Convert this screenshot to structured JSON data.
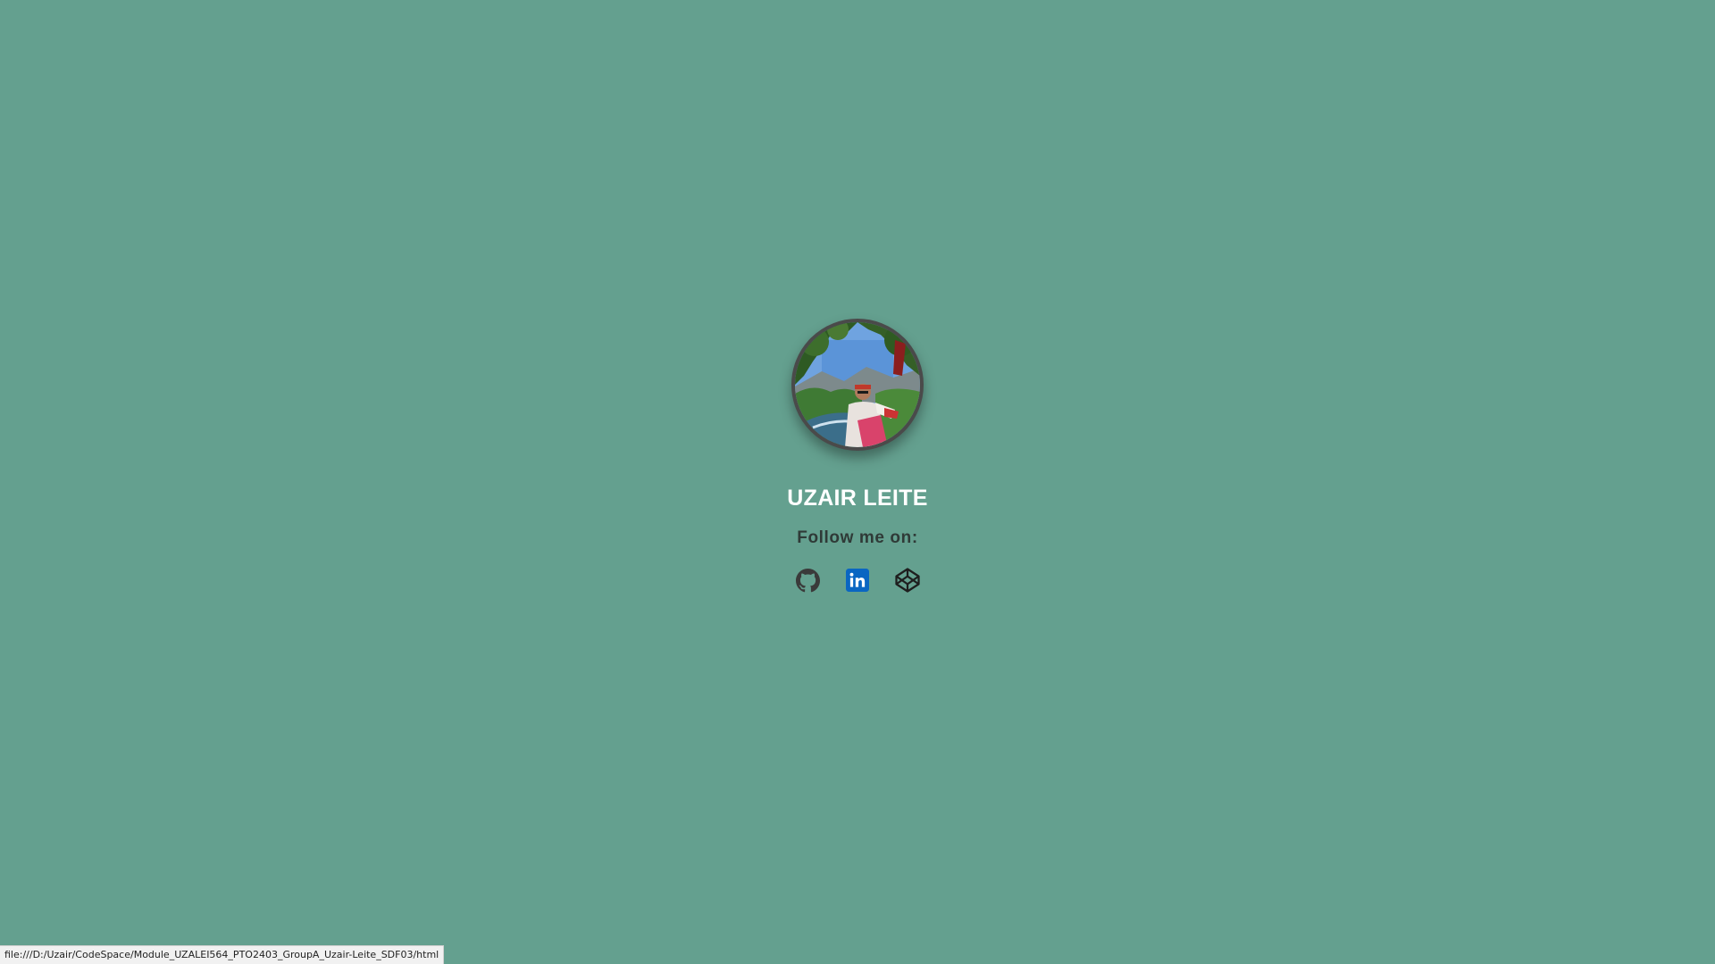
{
  "profile": {
    "name": "UZAIR LEITE",
    "follow_label": "Follow me on:"
  },
  "socials": [
    {
      "icon": "github-icon"
    },
    {
      "icon": "linkedin-icon",
      "color": "#0a66c2"
    },
    {
      "icon": "codepen-icon"
    }
  ],
  "status_bar": {
    "url": "file:///D:/Uzair/CodeSpace/Module_UZALEI564_PTO2403_GroupA_Uzair-Leite_SDF03/html"
  },
  "colors": {
    "background": "#64a08f",
    "name_text": "#ffffff",
    "follow_text": "#2f3a37"
  }
}
